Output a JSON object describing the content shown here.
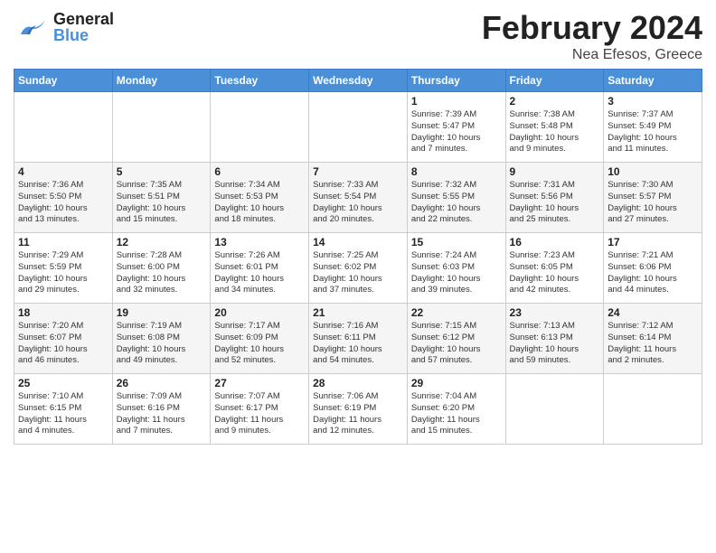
{
  "header": {
    "logo_general": "General",
    "logo_blue": "Blue",
    "month_title": "February 2024",
    "location": "Nea Efesos, Greece"
  },
  "days_of_week": [
    "Sunday",
    "Monday",
    "Tuesday",
    "Wednesday",
    "Thursday",
    "Friday",
    "Saturday"
  ],
  "weeks": [
    {
      "alt": false,
      "days": [
        {
          "date": "",
          "info": ""
        },
        {
          "date": "",
          "info": ""
        },
        {
          "date": "",
          "info": ""
        },
        {
          "date": "",
          "info": ""
        },
        {
          "date": "1",
          "info": "Sunrise: 7:39 AM\nSunset: 5:47 PM\nDaylight: 10 hours\nand 7 minutes."
        },
        {
          "date": "2",
          "info": "Sunrise: 7:38 AM\nSunset: 5:48 PM\nDaylight: 10 hours\nand 9 minutes."
        },
        {
          "date": "3",
          "info": "Sunrise: 7:37 AM\nSunset: 5:49 PM\nDaylight: 10 hours\nand 11 minutes."
        }
      ]
    },
    {
      "alt": true,
      "days": [
        {
          "date": "4",
          "info": "Sunrise: 7:36 AM\nSunset: 5:50 PM\nDaylight: 10 hours\nand 13 minutes."
        },
        {
          "date": "5",
          "info": "Sunrise: 7:35 AM\nSunset: 5:51 PM\nDaylight: 10 hours\nand 15 minutes."
        },
        {
          "date": "6",
          "info": "Sunrise: 7:34 AM\nSunset: 5:53 PM\nDaylight: 10 hours\nand 18 minutes."
        },
        {
          "date": "7",
          "info": "Sunrise: 7:33 AM\nSunset: 5:54 PM\nDaylight: 10 hours\nand 20 minutes."
        },
        {
          "date": "8",
          "info": "Sunrise: 7:32 AM\nSunset: 5:55 PM\nDaylight: 10 hours\nand 22 minutes."
        },
        {
          "date": "9",
          "info": "Sunrise: 7:31 AM\nSunset: 5:56 PM\nDaylight: 10 hours\nand 25 minutes."
        },
        {
          "date": "10",
          "info": "Sunrise: 7:30 AM\nSunset: 5:57 PM\nDaylight: 10 hours\nand 27 minutes."
        }
      ]
    },
    {
      "alt": false,
      "days": [
        {
          "date": "11",
          "info": "Sunrise: 7:29 AM\nSunset: 5:59 PM\nDaylight: 10 hours\nand 29 minutes."
        },
        {
          "date": "12",
          "info": "Sunrise: 7:28 AM\nSunset: 6:00 PM\nDaylight: 10 hours\nand 32 minutes."
        },
        {
          "date": "13",
          "info": "Sunrise: 7:26 AM\nSunset: 6:01 PM\nDaylight: 10 hours\nand 34 minutes."
        },
        {
          "date": "14",
          "info": "Sunrise: 7:25 AM\nSunset: 6:02 PM\nDaylight: 10 hours\nand 37 minutes."
        },
        {
          "date": "15",
          "info": "Sunrise: 7:24 AM\nSunset: 6:03 PM\nDaylight: 10 hours\nand 39 minutes."
        },
        {
          "date": "16",
          "info": "Sunrise: 7:23 AM\nSunset: 6:05 PM\nDaylight: 10 hours\nand 42 minutes."
        },
        {
          "date": "17",
          "info": "Sunrise: 7:21 AM\nSunset: 6:06 PM\nDaylight: 10 hours\nand 44 minutes."
        }
      ]
    },
    {
      "alt": true,
      "days": [
        {
          "date": "18",
          "info": "Sunrise: 7:20 AM\nSunset: 6:07 PM\nDaylight: 10 hours\nand 46 minutes."
        },
        {
          "date": "19",
          "info": "Sunrise: 7:19 AM\nSunset: 6:08 PM\nDaylight: 10 hours\nand 49 minutes."
        },
        {
          "date": "20",
          "info": "Sunrise: 7:17 AM\nSunset: 6:09 PM\nDaylight: 10 hours\nand 52 minutes."
        },
        {
          "date": "21",
          "info": "Sunrise: 7:16 AM\nSunset: 6:11 PM\nDaylight: 10 hours\nand 54 minutes."
        },
        {
          "date": "22",
          "info": "Sunrise: 7:15 AM\nSunset: 6:12 PM\nDaylight: 10 hours\nand 57 minutes."
        },
        {
          "date": "23",
          "info": "Sunrise: 7:13 AM\nSunset: 6:13 PM\nDaylight: 10 hours\nand 59 minutes."
        },
        {
          "date": "24",
          "info": "Sunrise: 7:12 AM\nSunset: 6:14 PM\nDaylight: 11 hours\nand 2 minutes."
        }
      ]
    },
    {
      "alt": false,
      "days": [
        {
          "date": "25",
          "info": "Sunrise: 7:10 AM\nSunset: 6:15 PM\nDaylight: 11 hours\nand 4 minutes."
        },
        {
          "date": "26",
          "info": "Sunrise: 7:09 AM\nSunset: 6:16 PM\nDaylight: 11 hours\nand 7 minutes."
        },
        {
          "date": "27",
          "info": "Sunrise: 7:07 AM\nSunset: 6:17 PM\nDaylight: 11 hours\nand 9 minutes."
        },
        {
          "date": "28",
          "info": "Sunrise: 7:06 AM\nSunset: 6:19 PM\nDaylight: 11 hours\nand 12 minutes."
        },
        {
          "date": "29",
          "info": "Sunrise: 7:04 AM\nSunset: 6:20 PM\nDaylight: 11 hours\nand 15 minutes."
        },
        {
          "date": "",
          "info": ""
        },
        {
          "date": "",
          "info": ""
        }
      ]
    }
  ]
}
